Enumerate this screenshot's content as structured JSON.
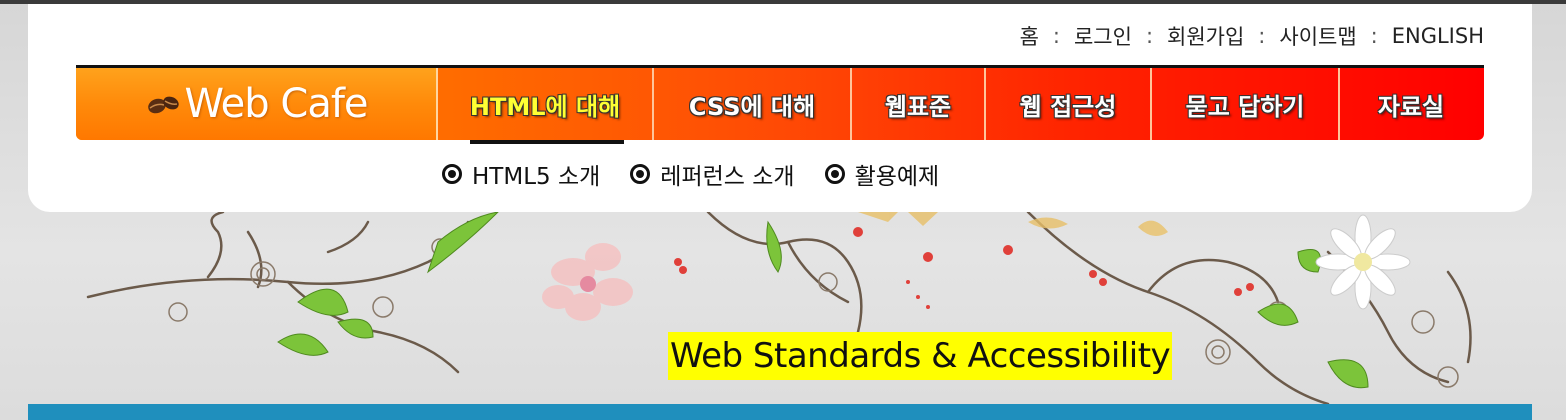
{
  "util_nav": {
    "items": [
      "홈",
      "로그인",
      "회원가입",
      "사이트맵",
      "ENGLISH"
    ],
    "separator": ":"
  },
  "logo": {
    "text": "Web Cafe",
    "icon": "coffee-beans-icon"
  },
  "main_nav": {
    "items": [
      {
        "label": "HTML에 대해",
        "active": true
      },
      {
        "label": "CSS에 대해",
        "active": false
      },
      {
        "label": "웹표준",
        "active": false
      },
      {
        "label": "웹 접근성",
        "active": false
      },
      {
        "label": "묻고 답하기",
        "active": false
      },
      {
        "label": "자료실",
        "active": false
      }
    ]
  },
  "sub_nav": {
    "bullet_icon": "circle-dot-icon",
    "items": [
      "HTML5 소개",
      "레퍼런스 소개",
      "활용예제"
    ]
  },
  "banner": {
    "slogan": "Web Standards & Accessibility"
  },
  "colors": {
    "nav_gradient_start": "#ff8a00",
    "nav_gradient_end": "#ff0000",
    "active_text": "#ffff33",
    "slogan_highlight": "#ffff00",
    "bottom_bar": "#1f8fbd"
  }
}
